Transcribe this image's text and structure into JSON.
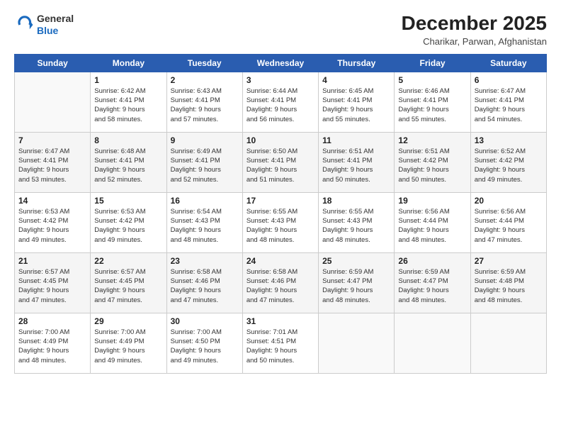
{
  "header": {
    "logo_general": "General",
    "logo_blue": "Blue",
    "title": "December 2025",
    "subtitle": "Charikar, Parwan, Afghanistan"
  },
  "calendar": {
    "days_of_week": [
      "Sunday",
      "Monday",
      "Tuesday",
      "Wednesday",
      "Thursday",
      "Friday",
      "Saturday"
    ],
    "weeks": [
      [
        {
          "day": "",
          "info": ""
        },
        {
          "day": "1",
          "info": "Sunrise: 6:42 AM\nSunset: 4:41 PM\nDaylight: 9 hours\nand 58 minutes."
        },
        {
          "day": "2",
          "info": "Sunrise: 6:43 AM\nSunset: 4:41 PM\nDaylight: 9 hours\nand 57 minutes."
        },
        {
          "day": "3",
          "info": "Sunrise: 6:44 AM\nSunset: 4:41 PM\nDaylight: 9 hours\nand 56 minutes."
        },
        {
          "day": "4",
          "info": "Sunrise: 6:45 AM\nSunset: 4:41 PM\nDaylight: 9 hours\nand 55 minutes."
        },
        {
          "day": "5",
          "info": "Sunrise: 6:46 AM\nSunset: 4:41 PM\nDaylight: 9 hours\nand 55 minutes."
        },
        {
          "day": "6",
          "info": "Sunrise: 6:47 AM\nSunset: 4:41 PM\nDaylight: 9 hours\nand 54 minutes."
        }
      ],
      [
        {
          "day": "7",
          "info": "Sunrise: 6:47 AM\nSunset: 4:41 PM\nDaylight: 9 hours\nand 53 minutes."
        },
        {
          "day": "8",
          "info": "Sunrise: 6:48 AM\nSunset: 4:41 PM\nDaylight: 9 hours\nand 52 minutes."
        },
        {
          "day": "9",
          "info": "Sunrise: 6:49 AM\nSunset: 4:41 PM\nDaylight: 9 hours\nand 52 minutes."
        },
        {
          "day": "10",
          "info": "Sunrise: 6:50 AM\nSunset: 4:41 PM\nDaylight: 9 hours\nand 51 minutes."
        },
        {
          "day": "11",
          "info": "Sunrise: 6:51 AM\nSunset: 4:41 PM\nDaylight: 9 hours\nand 50 minutes."
        },
        {
          "day": "12",
          "info": "Sunrise: 6:51 AM\nSunset: 4:42 PM\nDaylight: 9 hours\nand 50 minutes."
        },
        {
          "day": "13",
          "info": "Sunrise: 6:52 AM\nSunset: 4:42 PM\nDaylight: 9 hours\nand 49 minutes."
        }
      ],
      [
        {
          "day": "14",
          "info": "Sunrise: 6:53 AM\nSunset: 4:42 PM\nDaylight: 9 hours\nand 49 minutes."
        },
        {
          "day": "15",
          "info": "Sunrise: 6:53 AM\nSunset: 4:42 PM\nDaylight: 9 hours\nand 49 minutes."
        },
        {
          "day": "16",
          "info": "Sunrise: 6:54 AM\nSunset: 4:43 PM\nDaylight: 9 hours\nand 48 minutes."
        },
        {
          "day": "17",
          "info": "Sunrise: 6:55 AM\nSunset: 4:43 PM\nDaylight: 9 hours\nand 48 minutes."
        },
        {
          "day": "18",
          "info": "Sunrise: 6:55 AM\nSunset: 4:43 PM\nDaylight: 9 hours\nand 48 minutes."
        },
        {
          "day": "19",
          "info": "Sunrise: 6:56 AM\nSunset: 4:44 PM\nDaylight: 9 hours\nand 48 minutes."
        },
        {
          "day": "20",
          "info": "Sunrise: 6:56 AM\nSunset: 4:44 PM\nDaylight: 9 hours\nand 47 minutes."
        }
      ],
      [
        {
          "day": "21",
          "info": "Sunrise: 6:57 AM\nSunset: 4:45 PM\nDaylight: 9 hours\nand 47 minutes."
        },
        {
          "day": "22",
          "info": "Sunrise: 6:57 AM\nSunset: 4:45 PM\nDaylight: 9 hours\nand 47 minutes."
        },
        {
          "day": "23",
          "info": "Sunrise: 6:58 AM\nSunset: 4:46 PM\nDaylight: 9 hours\nand 47 minutes."
        },
        {
          "day": "24",
          "info": "Sunrise: 6:58 AM\nSunset: 4:46 PM\nDaylight: 9 hours\nand 47 minutes."
        },
        {
          "day": "25",
          "info": "Sunrise: 6:59 AM\nSunset: 4:47 PM\nDaylight: 9 hours\nand 48 minutes."
        },
        {
          "day": "26",
          "info": "Sunrise: 6:59 AM\nSunset: 4:47 PM\nDaylight: 9 hours\nand 48 minutes."
        },
        {
          "day": "27",
          "info": "Sunrise: 6:59 AM\nSunset: 4:48 PM\nDaylight: 9 hours\nand 48 minutes."
        }
      ],
      [
        {
          "day": "28",
          "info": "Sunrise: 7:00 AM\nSunset: 4:49 PM\nDaylight: 9 hours\nand 48 minutes."
        },
        {
          "day": "29",
          "info": "Sunrise: 7:00 AM\nSunset: 4:49 PM\nDaylight: 9 hours\nand 49 minutes."
        },
        {
          "day": "30",
          "info": "Sunrise: 7:00 AM\nSunset: 4:50 PM\nDaylight: 9 hours\nand 49 minutes."
        },
        {
          "day": "31",
          "info": "Sunrise: 7:01 AM\nSunset: 4:51 PM\nDaylight: 9 hours\nand 50 minutes."
        },
        {
          "day": "",
          "info": ""
        },
        {
          "day": "",
          "info": ""
        },
        {
          "day": "",
          "info": ""
        }
      ]
    ]
  }
}
